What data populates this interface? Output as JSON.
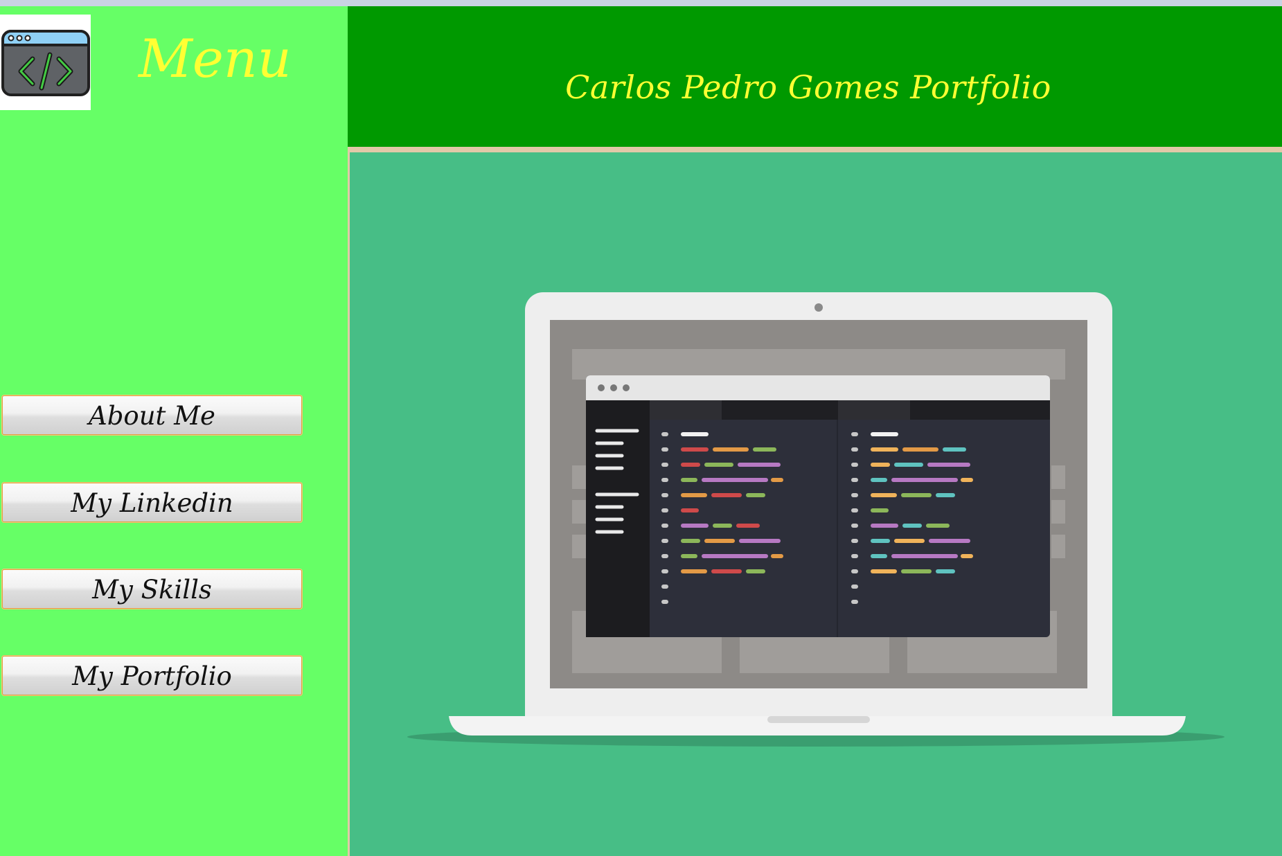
{
  "sidebar": {
    "menu_title": "Menu",
    "logo_icon": "code-window-icon",
    "buttons": [
      {
        "label": "About Me"
      },
      {
        "label": "My Linkedin"
      },
      {
        "label": "My Skills"
      },
      {
        "label": "My Portfolio"
      }
    ]
  },
  "header": {
    "title": "Carlos Pedro Gomes Portfolio"
  },
  "main": {
    "illustration_icon": "laptop-code-editor-illustration"
  },
  "colors": {
    "sidebar_bg": "#66ff66",
    "header_bg": "#009900",
    "main_bg": "#47be86",
    "title_text": "#ffff33"
  }
}
